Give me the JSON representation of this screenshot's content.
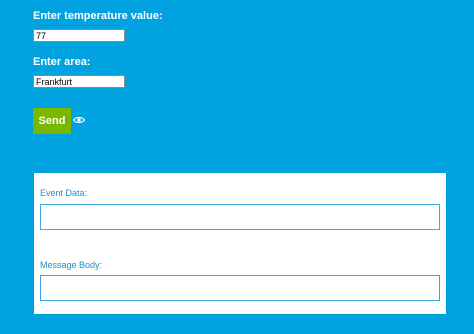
{
  "form": {
    "temperature": {
      "label": "Enter temperature value:",
      "value": "77"
    },
    "area": {
      "label": "Enter area:",
      "value": "Frankfurt"
    },
    "send_label": "Send"
  },
  "icons": {
    "preview": "eye-icon"
  },
  "output": {
    "event_data": {
      "label": "Event Data:",
      "value": ""
    },
    "message_body": {
      "label": "Message Body:",
      "value": ""
    }
  },
  "colors": {
    "background": "#00a3e0",
    "send_button": "#7ab800",
    "panel_label": "#1a8fcc",
    "panel_border": "#3aa7df"
  }
}
